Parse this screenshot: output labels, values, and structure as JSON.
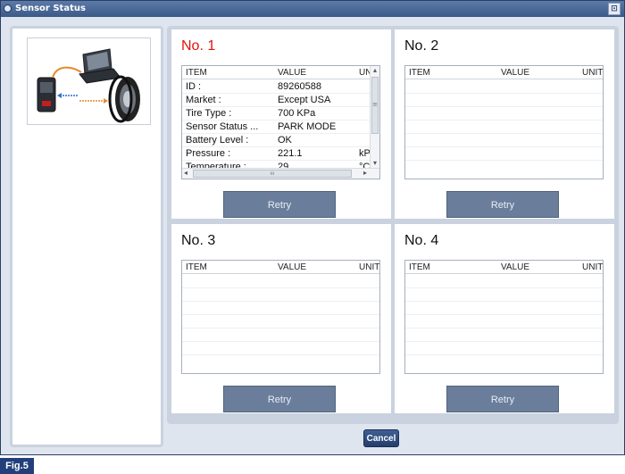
{
  "window": {
    "title": "Sensor Status",
    "close_glyph": "⊡"
  },
  "illustration": {
    "icons": [
      "laptop-icon",
      "scan-tool-icon",
      "tire-icon"
    ],
    "colors": {
      "arrow_blue": "#2f6fd2",
      "arrow_orange": "#e7892f"
    }
  },
  "panels": [
    {
      "title": "No. 1",
      "active": true,
      "columns": [
        "ITEM",
        "VALUE",
        "UNIᵀ"
      ],
      "rows": [
        {
          "item": "ID :",
          "value": "89260588",
          "unit": ""
        },
        {
          "item": "Market :",
          "value": "Except USA",
          "unit": ""
        },
        {
          "item": "Tire Type :",
          "value": "700 KPa",
          "unit": ""
        },
        {
          "item": "Sensor Status ...",
          "value": "PARK MODE",
          "unit": ""
        },
        {
          "item": "Battery Level :",
          "value": "OK",
          "unit": ""
        },
        {
          "item": "Pressure :",
          "value": "221.1",
          "unit": "kPa"
        },
        {
          "item": "Temperature :",
          "value": "29",
          "unit": "°C"
        }
      ],
      "retry_label": "Retry"
    },
    {
      "title": "No. 2",
      "active": false,
      "columns": [
        "ITEM",
        "VALUE",
        "UNIT"
      ],
      "rows": [],
      "retry_label": "Retry"
    },
    {
      "title": "No. 3",
      "active": false,
      "columns": [
        "ITEM",
        "VALUE",
        "UNIT"
      ],
      "rows": [],
      "retry_label": "Retry"
    },
    {
      "title": "No. 4",
      "active": false,
      "columns": [
        "ITEM",
        "VALUE",
        "UNIT"
      ],
      "rows": [],
      "retry_label": "Retry"
    }
  ],
  "cancel_label": "Cancel",
  "figure_label": "Fig.5",
  "scroll_glyphs": {
    "up": "▴",
    "down": "▾",
    "left": "◂",
    "right": "▸",
    "thumb": "≡",
    "hthumb": "ııı"
  }
}
